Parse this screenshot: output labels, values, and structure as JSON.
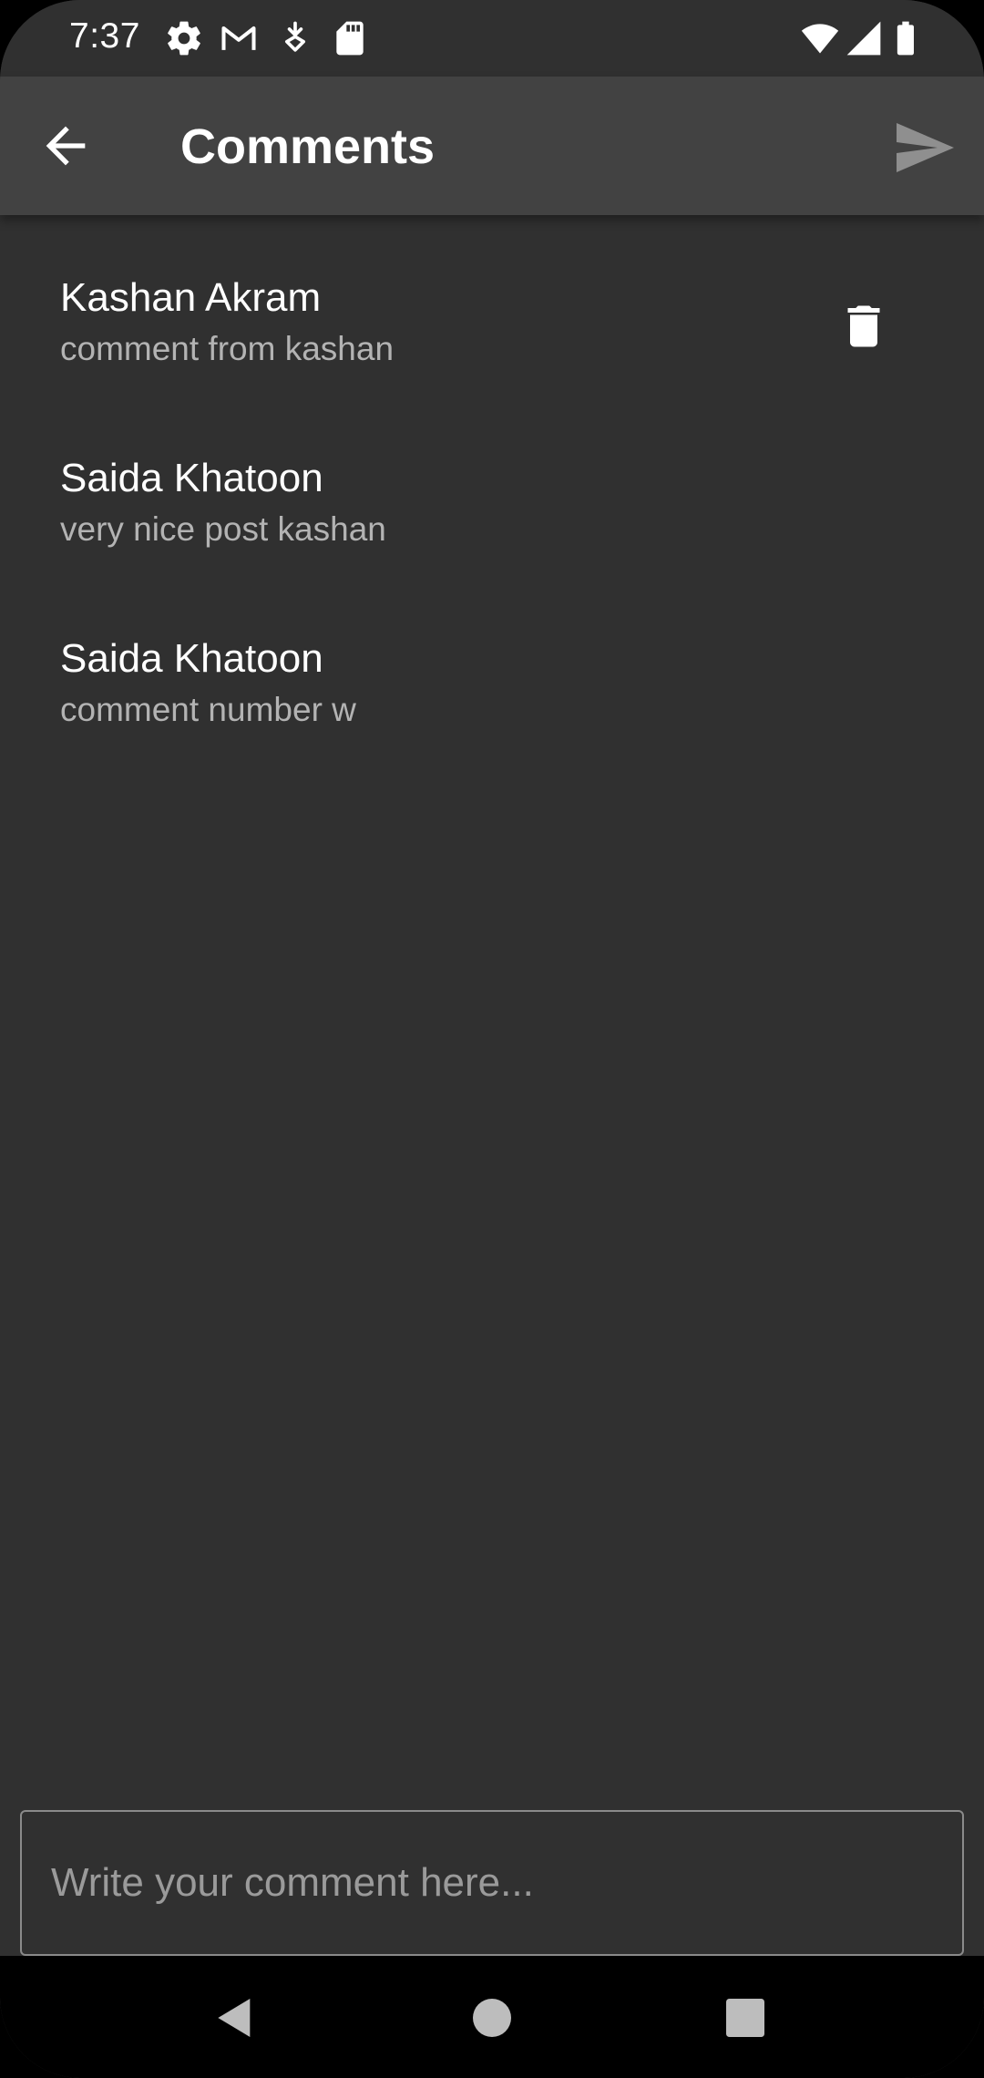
{
  "status_bar": {
    "time": "7:37",
    "icons": [
      "gear-icon",
      "gmail-icon",
      "download-icon",
      "sd-card-icon",
      "wifi-icon",
      "signal-icon",
      "battery-icon"
    ]
  },
  "app_bar": {
    "title": "Comments",
    "back_icon": "arrow-back-icon",
    "send_icon": "send-icon"
  },
  "comments": [
    {
      "author": "Kashan Akram",
      "text": "comment from kashan",
      "deletable": true
    },
    {
      "author": "Saida Khatoon",
      "text": "very nice post kashan",
      "deletable": false
    },
    {
      "author": "Saida Khatoon",
      "text": "comment number w",
      "deletable": false
    }
  ],
  "comment_input": {
    "value": "",
    "placeholder": "Write your comment here..."
  },
  "colors": {
    "background": "#303030",
    "app_bar": "#424242",
    "primary_text": "#ffffff",
    "secondary_text": "#b3b3b3"
  }
}
